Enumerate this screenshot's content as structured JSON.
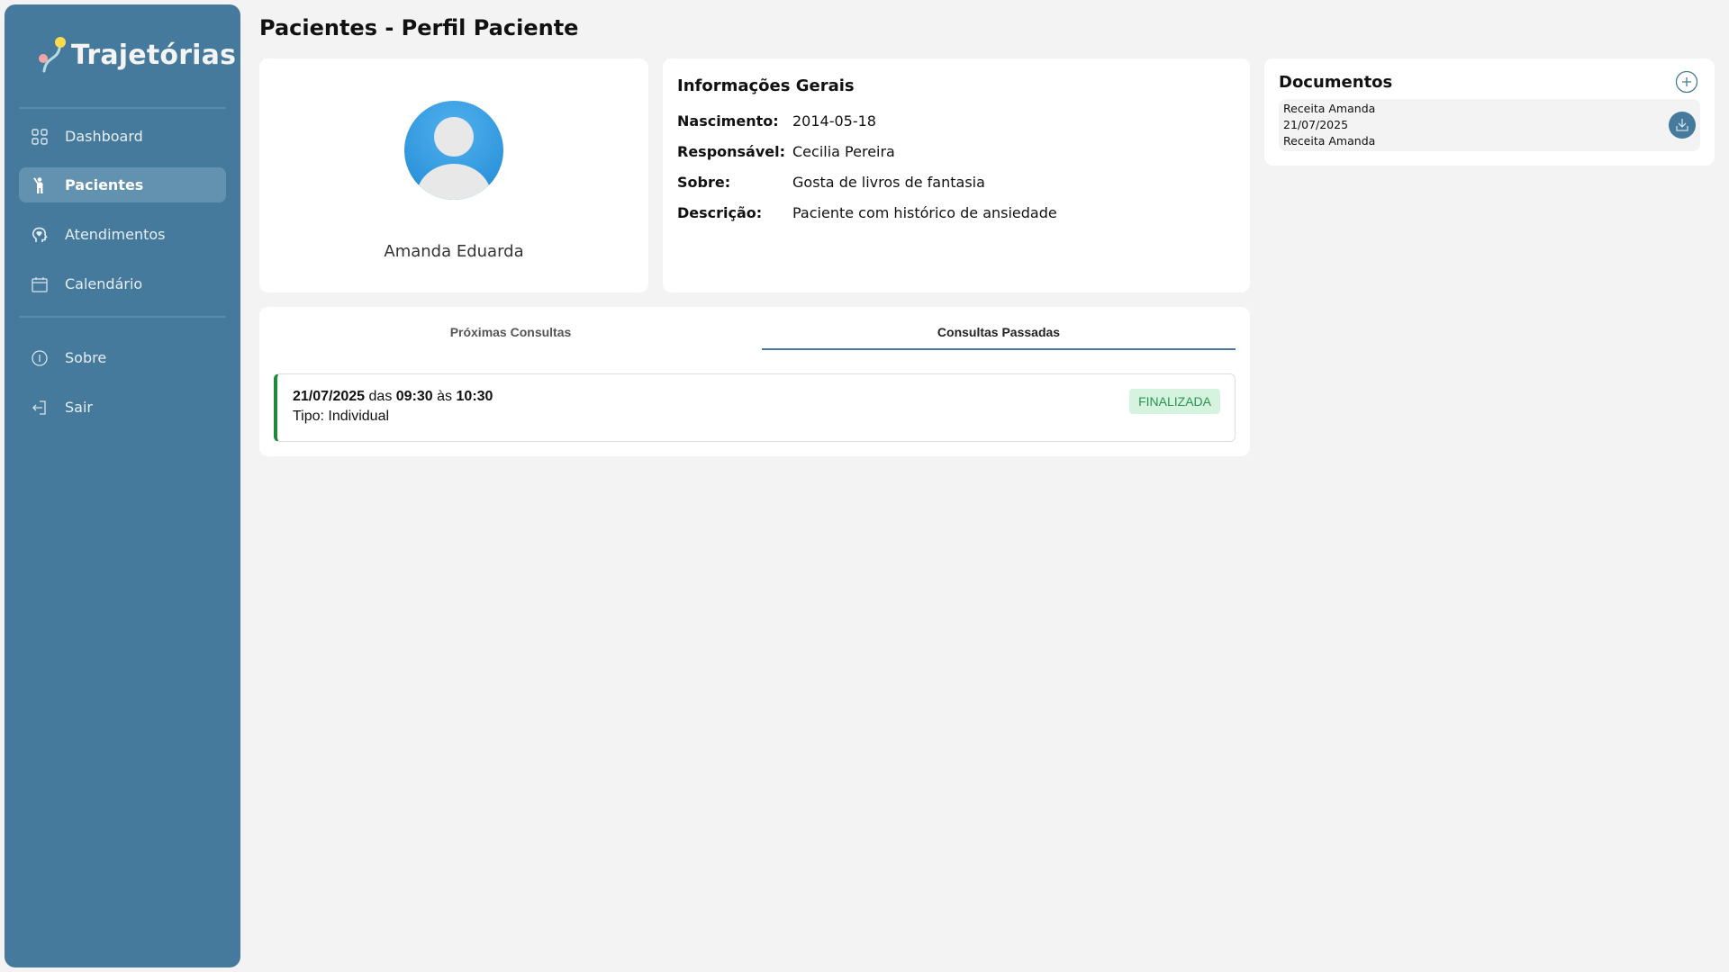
{
  "app": {
    "name": "Trajetórias"
  },
  "sidebar": {
    "items": [
      {
        "label": "Dashboard",
        "icon": "grid-icon"
      },
      {
        "label": "Pacientes",
        "icon": "person-waving-icon",
        "active": true
      },
      {
        "label": "Atendimentos",
        "icon": "head-heart-icon"
      },
      {
        "label": "Calendário",
        "icon": "calendar-icon"
      },
      {
        "label": "Sobre",
        "icon": "info-icon"
      },
      {
        "label": "Sair",
        "icon": "logout-icon"
      }
    ]
  },
  "page": {
    "title": "Pacientes - Perfil Paciente"
  },
  "profile": {
    "name": "Amanda Eduarda"
  },
  "info": {
    "heading": "Informações Gerais",
    "rows": [
      {
        "label": "Nascimento:",
        "value": "2014-05-18"
      },
      {
        "label": "Responsável:",
        "value": "Cecilia Pereira"
      },
      {
        "label": "Sobre:",
        "value": "Gosta de livros de fantasia"
      },
      {
        "label": "Descrição:",
        "value": "Paciente com histórico de ansiedade"
      }
    ]
  },
  "documents": {
    "heading": "Documentos",
    "items": [
      {
        "title": "Receita Amanda",
        "date": "21/07/2025",
        "description": "Receita Amanda"
      }
    ]
  },
  "tabs": {
    "items": [
      "Próximas Consultas",
      "Consultas Passadas"
    ],
    "active": 1
  },
  "appointments": [
    {
      "date": "21/07/2025",
      "from_word": "das",
      "start": "09:30",
      "to_word": "às",
      "end": "10:30",
      "type": "Tipo: Individual",
      "status": "FINALIZADA",
      "status_color": "#2b9450"
    }
  ],
  "colors": {
    "sidebar": "#467a9c",
    "accent": "#467a9c",
    "success": "#1e8a3c"
  }
}
